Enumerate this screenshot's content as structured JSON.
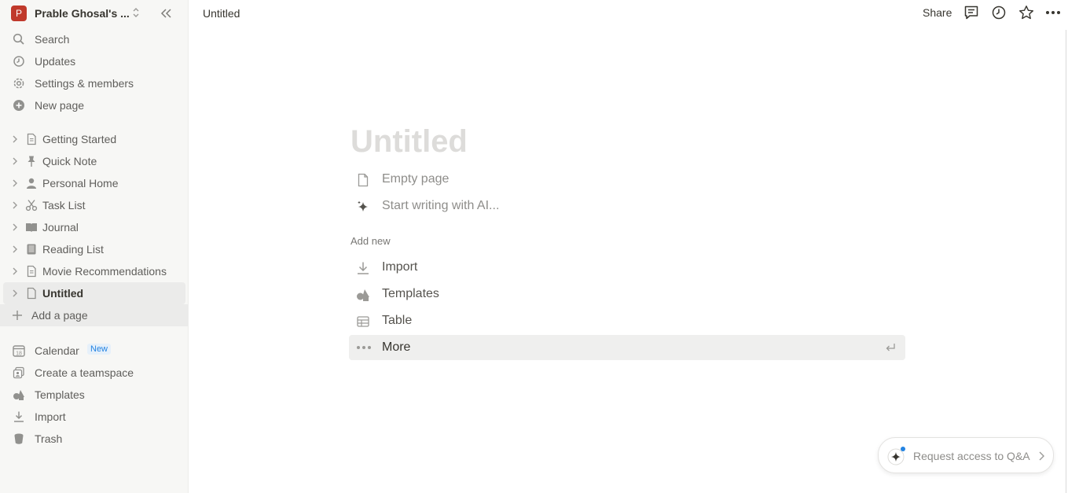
{
  "workspace": {
    "avatar_letter": "P",
    "name": "Prable Ghosal's ...",
    "accent": "#c0392b"
  },
  "sidebar": {
    "nav": [
      {
        "label": "Search",
        "icon": "search-icon"
      },
      {
        "label": "Updates",
        "icon": "clock-icon"
      },
      {
        "label": "Settings & members",
        "icon": "gear-icon"
      },
      {
        "label": "New page",
        "icon": "plus-circle-icon"
      }
    ],
    "pages": [
      {
        "label": "Getting Started",
        "icon": "page-icon"
      },
      {
        "label": "Quick Note",
        "icon": "pin-icon"
      },
      {
        "label": "Personal Home",
        "icon": "person-icon"
      },
      {
        "label": "Task List",
        "icon": "scissors-icon"
      },
      {
        "label": "Journal",
        "icon": "book-icon"
      },
      {
        "label": "Reading List",
        "icon": "notebook-icon"
      },
      {
        "label": "Movie Recommendations",
        "icon": "page-icon"
      },
      {
        "label": "Untitled",
        "icon": "page-icon",
        "active": true
      }
    ],
    "add_page": "Add a page",
    "bottom": [
      {
        "label": "Calendar",
        "icon": "calendar-icon",
        "badge": "New",
        "calendar_day": "18"
      },
      {
        "label": "Create a teamspace",
        "icon": "teamspace-icon"
      },
      {
        "label": "Templates",
        "icon": "shapes-icon"
      },
      {
        "label": "Import",
        "icon": "download-icon"
      },
      {
        "label": "Trash",
        "icon": "trash-icon"
      }
    ]
  },
  "topbar": {
    "breadcrumb": "Untitled",
    "share": "Share"
  },
  "main": {
    "title_placeholder": "Untitled",
    "options": [
      {
        "label": "Empty page",
        "icon": "page-icon"
      },
      {
        "label": "Start writing with AI...",
        "icon": "sparkle-icon"
      }
    ],
    "add_new_label": "Add new",
    "add_new": [
      {
        "label": "Import",
        "icon": "download-icon"
      },
      {
        "label": "Templates",
        "icon": "shapes-icon"
      },
      {
        "label": "Table",
        "icon": "table-icon"
      },
      {
        "label": "More",
        "icon": "more-dots-icon",
        "highlighted": true
      }
    ]
  },
  "qa_button": {
    "label": "Request access to Q&A",
    "dot_color": "#2383e2"
  }
}
